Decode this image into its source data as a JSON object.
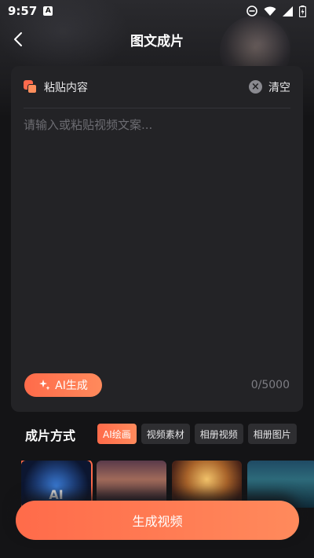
{
  "status_bar": {
    "time": "9:57",
    "indicator": "A",
    "icons": [
      "dnd-icon",
      "wifi-icon",
      "signal-icon",
      "battery-icon"
    ]
  },
  "nav": {
    "title": "图文成片",
    "back_icon": "chevron-left-icon"
  },
  "editor": {
    "paste_label": "粘贴内容",
    "clear_label": "清空",
    "placeholder": "请输入或粘贴视频文案...",
    "value": "",
    "ai_button_label": "AI生成",
    "counter": "0/5000"
  },
  "method": {
    "title": "成片方式",
    "chips": [
      {
        "label": "AI绘画",
        "active": true
      },
      {
        "label": "视频素材",
        "active": false
      },
      {
        "label": "相册视频",
        "active": false
      },
      {
        "label": "相册图片",
        "active": false
      }
    ]
  },
  "thumbnails": [
    {
      "name": "ai-style-thumb",
      "text": "AI",
      "selected": true
    },
    {
      "name": "couple-city-thumb",
      "text": "",
      "selected": false
    },
    {
      "name": "golden-dragon-thumb",
      "text": "",
      "selected": false
    },
    {
      "name": "mountain-temple-thumb",
      "text": "",
      "selected": false
    }
  ],
  "footer": {
    "generate_label": "生成视频"
  },
  "colors": {
    "accent_start": "#ff6b4a",
    "accent_end": "#ff8a5c",
    "background": "#141416",
    "card": "#232326"
  }
}
